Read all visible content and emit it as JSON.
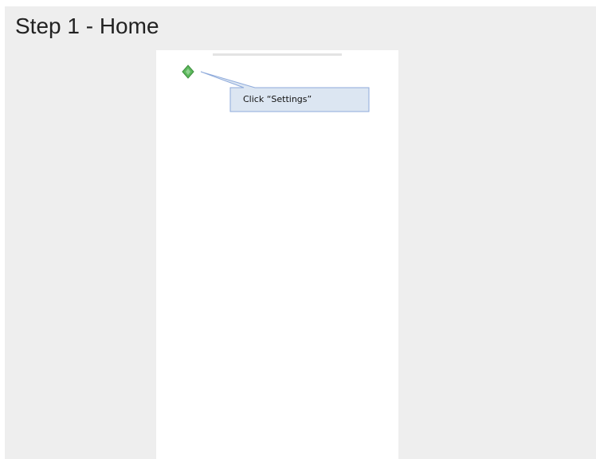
{
  "step": {
    "title": "Step 1 - Home"
  },
  "callout": {
    "text": "Click “Settings”",
    "fill_color": "#dce6f2",
    "border_color": "#8eaadb"
  },
  "marker": {
    "icon": "green-diamond-icon",
    "color": "#5cb85c"
  }
}
